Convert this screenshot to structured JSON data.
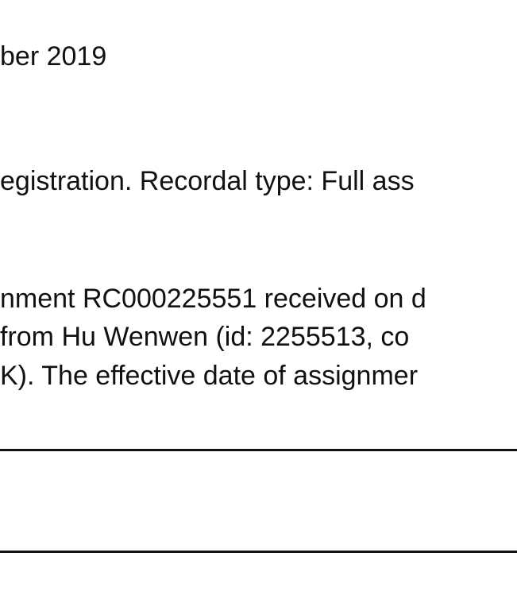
{
  "document": {
    "lines": [
      "ber 2019",
      "egistration. Recordal type: Full ass",
      "nment RC000225551 received on d",
      " from Hu Wenwen (id: 2255513, co",
      "K). The effective date of assignmer"
    ]
  }
}
